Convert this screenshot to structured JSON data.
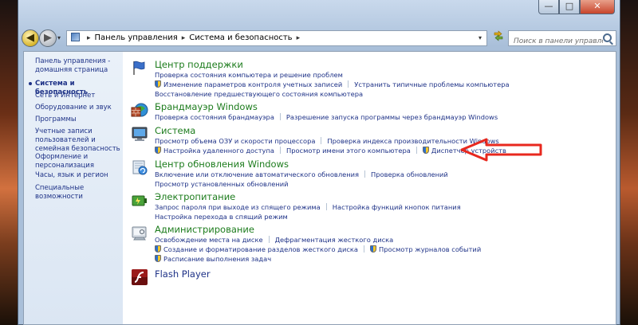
{
  "window": {
    "controls": {
      "minimize": "—",
      "maximize": "□",
      "close": "✕"
    }
  },
  "nav": {
    "back": "◀",
    "forward": "▶",
    "dropdown": "▾",
    "separator": "▸",
    "breadcrumb": [
      "Панель управления",
      "Система и безопасность"
    ],
    "search_placeholder": "Поиск в панели управления"
  },
  "sidebar": {
    "items": [
      {
        "label": "Панель управления - домашняя страница"
      },
      {
        "label": "Система и безопасность",
        "current": true
      },
      {
        "label": "Сеть и Интернет"
      },
      {
        "label": "Оборудование и звук"
      },
      {
        "label": "Программы"
      },
      {
        "label": "Учетные записи пользователей и семейная безопасность"
      },
      {
        "label": "Оформление и персонализация"
      },
      {
        "label": "Часы, язык и регион"
      },
      {
        "label": "Специальные возможности"
      }
    ]
  },
  "categories": [
    {
      "title": "Центр поддержки",
      "icon": "flag-icon",
      "rows": [
        [
          {
            "label": "Проверка состояния компьютера и решение проблем"
          }
        ],
        [
          {
            "label": "Изменение параметров контроля учетных записей",
            "shield": true
          },
          {
            "label": "Устранить типичные проблемы компьютера"
          }
        ],
        [
          {
            "label": "Восстановление предшествующего состояния компьютера"
          }
        ]
      ]
    },
    {
      "title": "Брандмауэр Windows",
      "icon": "firewall-icon",
      "rows": [
        [
          {
            "label": "Проверка состояния брандмауэра"
          },
          {
            "label": "Разрешение запуска программы через брандмауэр Windows"
          }
        ]
      ]
    },
    {
      "title": "Система",
      "icon": "computer-icon",
      "rows": [
        [
          {
            "label": "Просмотр объема ОЗУ и скорости процессора"
          },
          {
            "label": "Проверка индекса производительности Windows"
          }
        ],
        [
          {
            "label": "Настройка удаленного доступа",
            "shield": true
          },
          {
            "label": "Просмотр имени этого компьютера"
          },
          {
            "label": "Диспетчер устройств",
            "shield": true
          }
        ]
      ]
    },
    {
      "title": "Центр обновления Windows",
      "icon": "windows-update-icon",
      "rows": [
        [
          {
            "label": "Включение или отключение автоматического обновления"
          },
          {
            "label": "Проверка обновлений"
          }
        ],
        [
          {
            "label": "Просмотр установленных обновлений"
          }
        ]
      ]
    },
    {
      "title": "Электропитание",
      "icon": "power-icon",
      "rows": [
        [
          {
            "label": "Запрос пароля при выходе из спящего режима"
          },
          {
            "label": "Настройка функций кнопок питания"
          }
        ],
        [
          {
            "label": "Настройка перехода в спящий режим"
          }
        ]
      ]
    },
    {
      "title": "Администрирование",
      "icon": "admin-tools-icon",
      "rows": [
        [
          {
            "label": "Освобождение места на диске"
          },
          {
            "label": "Дефрагментация жесткого диска"
          }
        ],
        [
          {
            "label": "Создание и форматирование разделов жесткого диска",
            "shield": true
          },
          {
            "label": "Просмотр журналов событий",
            "shield": true
          }
        ],
        [
          {
            "label": "Расписание выполнения задач",
            "shield": true
          }
        ]
      ]
    },
    {
      "title": "Flash Player",
      "icon": "flash-icon",
      "rows": []
    }
  ],
  "colors": {
    "category_title": "#1d7c1d",
    "link": "#1e3287",
    "annotation_arrow": "#e8281e"
  }
}
